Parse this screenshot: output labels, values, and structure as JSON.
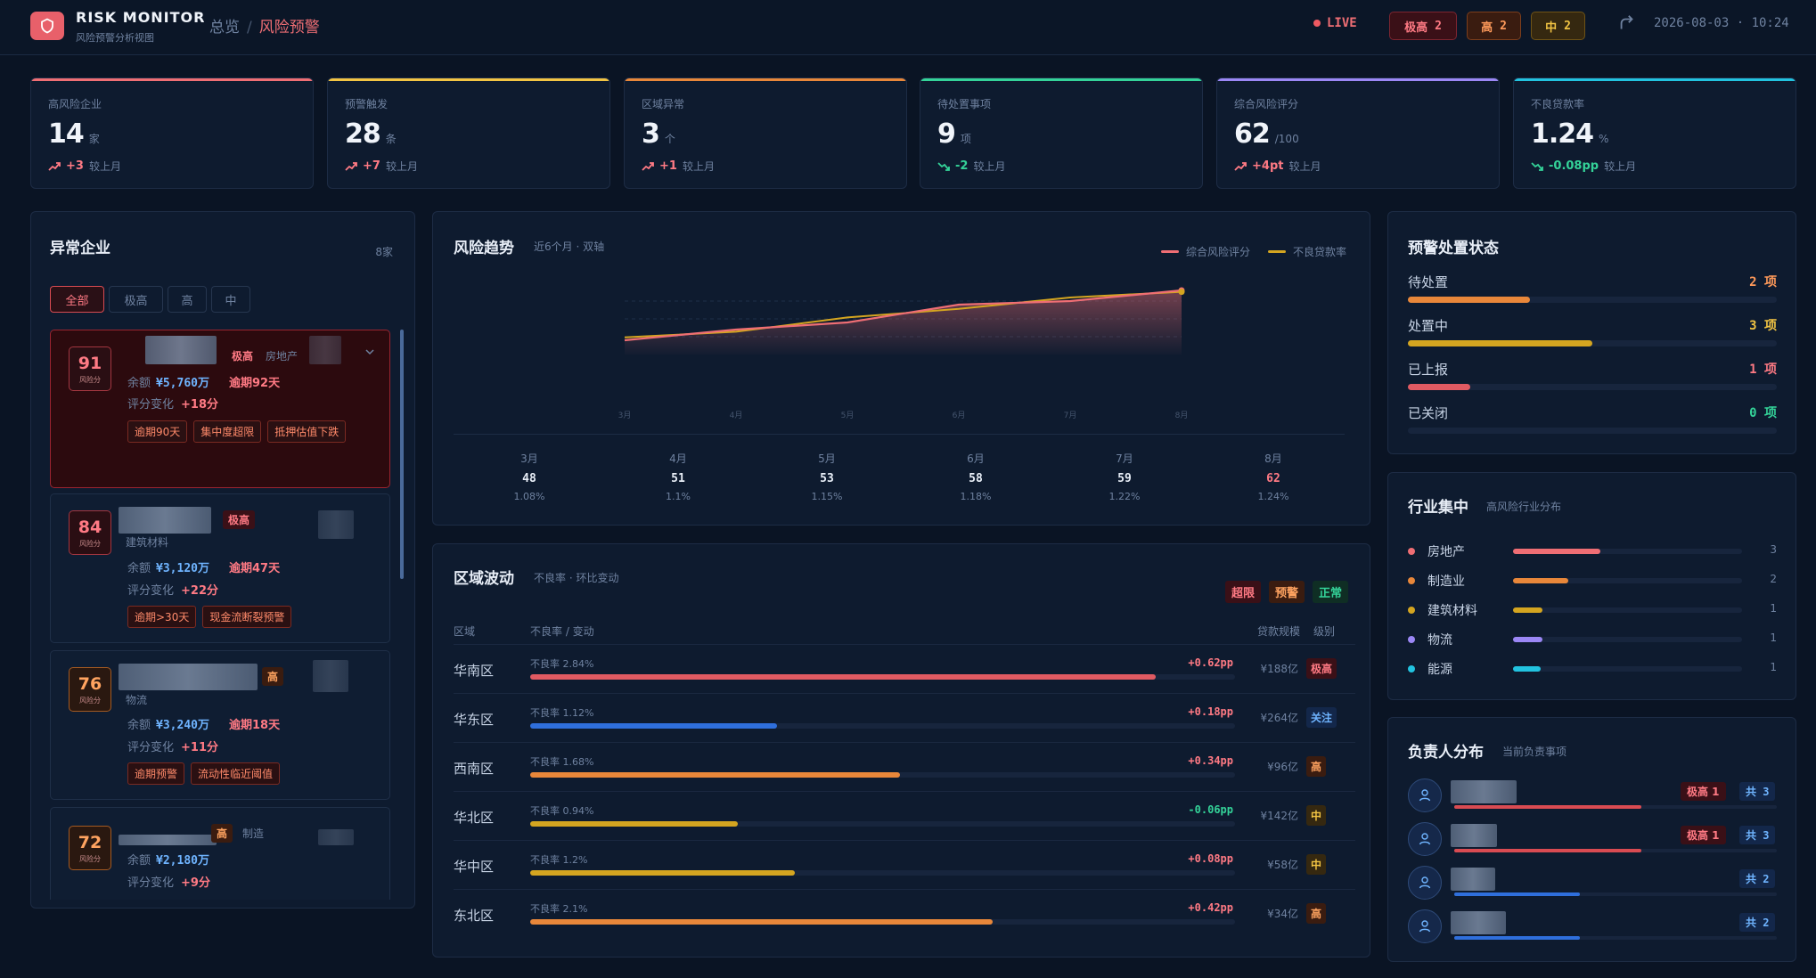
{
  "header": {
    "brand": "RISK MONITOR",
    "brand_sub": "风险预警分析视图",
    "crumb_home": "总览",
    "crumb_sep": "/",
    "crumb_current": "风险预警",
    "live": "LIVE",
    "badge_extreme": {
      "label": "极高",
      "count": "2"
    },
    "badge_high": {
      "label": "高",
      "count": "2"
    },
    "badge_mid": {
      "label": "中",
      "count": "2"
    },
    "datetime": "2026-08-03 · 10:24"
  },
  "colors": {
    "red": "#ef6e74",
    "amber": "#f2c443",
    "orange": "#e8873a",
    "green": "#34d399",
    "purple": "#9b87f5",
    "cyan": "#22c3e0",
    "blue": "#2f6fdc"
  },
  "kpis": [
    {
      "label": "高风险企业",
      "value": "14",
      "unit": "家",
      "change": "+3",
      "cmp": "较上月",
      "dir": "up",
      "color": "#ef6e74"
    },
    {
      "label": "预警触发",
      "value": "28",
      "unit": "条",
      "change": "+7",
      "cmp": "较上月",
      "dir": "up",
      "color": "#f2c443"
    },
    {
      "label": "区域异常",
      "value": "3",
      "unit": "个",
      "change": "+1",
      "cmp": "较上月",
      "dir": "up",
      "color": "#e8873a"
    },
    {
      "label": "待处置事项",
      "value": "9",
      "unit": "项",
      "change": "-2",
      "cmp": "较上月",
      "dir": "down",
      "color": "#34d399"
    },
    {
      "label": "综合风险评分",
      "value": "62",
      "unit": "/100",
      "change": "+4pt",
      "cmp": "较上月",
      "dir": "up",
      "color": "#9b87f5"
    },
    {
      "label": "不良贷款率",
      "value": "1.24",
      "unit": "%",
      "change": "-0.08pp",
      "cmp": "较上月",
      "dir": "down",
      "color": "#22c3e0"
    }
  ],
  "abnormal": {
    "title": "异常企业",
    "count": "8家",
    "filters": [
      "全部",
      "极高",
      "高",
      "中"
    ],
    "items": [
      {
        "score": "91",
        "score_label": "风险分",
        "level": "极高",
        "industry": "房地产",
        "balance_label": "余额",
        "balance": "¥5,760万",
        "overdue": "逾期92天",
        "change_label": "评分变化",
        "change": "+18分",
        "tags": [
          "逾期90天",
          "集中度超限",
          "抵押估值下跌"
        ]
      },
      {
        "score": "84",
        "score_label": "风险分",
        "level": "极高",
        "industry": "建筑材料",
        "balance_label": "余额",
        "balance": "¥3,120万",
        "overdue": "逾期47天",
        "change_label": "评分变化",
        "change": "+22分",
        "tags": [
          "逾期>30天",
          "现金流断裂预警"
        ]
      },
      {
        "score": "76",
        "score_label": "风险分",
        "level": "高",
        "industry": "物流",
        "balance_label": "余额",
        "balance": "¥3,240万",
        "overdue": "逾期18天",
        "change_label": "评分变化",
        "change": "+11分",
        "tags": [
          "逾期预警",
          "流动性临近阈值"
        ]
      },
      {
        "score": "72",
        "score_label": "风险分",
        "level": "高",
        "industry": "制造",
        "balance_label": "余额",
        "balance": "¥2,180万",
        "overdue": "",
        "change_label": "评分变化",
        "change": "+9分",
        "tags": []
      }
    ]
  },
  "trend": {
    "title": "风险趋势",
    "subtitle": "近6个月 · 双轴",
    "legend": [
      "综合风险评分",
      "不良贷款率"
    ]
  },
  "chart_data": {
    "type": "line",
    "x": [
      "3月",
      "4月",
      "5月",
      "6月",
      "7月",
      "8月"
    ],
    "series": [
      {
        "name": "综合风险评分",
        "values": [
          48,
          51,
          53,
          58,
          59,
          62
        ],
        "color": "#ef6e74"
      },
      {
        "name": "不良贷款率",
        "values": [
          1.08,
          1.1,
          1.15,
          1.18,
          1.22,
          1.24
        ],
        "color": "#d4a520"
      }
    ],
    "value_labels": [
      "1.08%",
      "1.1%",
      "1.15%",
      "1.18%",
      "1.22%",
      "1.24%"
    ],
    "axis_ticks": [
      "3月",
      "4月",
      "5月",
      "6月",
      "7月",
      "8月"
    ],
    "ylim_score": [
      44,
      64
    ],
    "ylim_rate": [
      1.02,
      1.27
    ],
    "grid": true,
    "legend_position": "top-right"
  },
  "regional": {
    "title": "区域波动",
    "subtitle": "不良率 · 环比变动",
    "badges": [
      "超限",
      "预警",
      "正常"
    ],
    "headers": {
      "region": "区域",
      "rate": "不良率 / 变动",
      "scale": "贷款规模",
      "level": "级别"
    },
    "rows": [
      {
        "name": "华南区",
        "rate_label": "不良率 2.84%",
        "rate": 2.84,
        "delta": "+0.62pp",
        "scale": "¥188亿",
        "level": "极高",
        "kind": "red"
      },
      {
        "name": "华东区",
        "rate_label": "不良率 1.12%",
        "rate": 1.12,
        "delta": "+0.18pp",
        "scale": "¥264亿",
        "level": "关注",
        "kind": "blue"
      },
      {
        "name": "西南区",
        "rate_label": "不良率 1.68%",
        "rate": 1.68,
        "delta": "+0.34pp",
        "scale": "¥96亿",
        "level": "高",
        "kind": "orange"
      },
      {
        "name": "华北区",
        "rate_label": "不良率 0.94%",
        "rate": 0.94,
        "delta": "-0.06pp",
        "scale": "¥142亿",
        "level": "中",
        "kind": "amber"
      },
      {
        "name": "华中区",
        "rate_label": "不良率 1.2%",
        "rate": 1.2,
        "delta": "+0.08pp",
        "scale": "¥58亿",
        "level": "中",
        "kind": "amber"
      },
      {
        "name": "东北区",
        "rate_label": "不良率 2.1%",
        "rate": 2.1,
        "delta": "+0.42pp",
        "scale": "¥34亿",
        "level": "高",
        "kind": "orange"
      }
    ]
  },
  "status": {
    "title": "预警处置状态",
    "rows": [
      {
        "label": "待处置",
        "value": "2 项",
        "fraction": 0.33,
        "color": "#e8873a",
        "vcolor": "#ff9a5a"
      },
      {
        "label": "处置中",
        "value": "3 项",
        "fraction": 0.5,
        "color": "#d4a520",
        "vcolor": "#f2c443"
      },
      {
        "label": "已上报",
        "value": "1 项",
        "fraction": 0.17,
        "color": "#e05a62",
        "vcolor": "#ff7a84"
      },
      {
        "label": "已关闭",
        "value": "0 项",
        "fraction": 0,
        "color": "#34d399",
        "vcolor": "#34d399"
      }
    ]
  },
  "industry": {
    "title": "行业集中",
    "subtitle": "高风险行业分布",
    "rows": [
      {
        "name": "房地产",
        "count": "3",
        "fraction": 0.38,
        "color": "#ef6e74"
      },
      {
        "name": "制造业",
        "count": "2",
        "fraction": 0.24,
        "color": "#e8873a"
      },
      {
        "name": "建筑材料",
        "count": "1",
        "fraction": 0.13,
        "color": "#d4a520"
      },
      {
        "name": "物流",
        "count": "1",
        "fraction": 0.13,
        "color": "#9b87f5"
      },
      {
        "name": "能源",
        "count": "1",
        "fraction": 0.12,
        "color": "#22c3e0"
      }
    ]
  },
  "owners": {
    "title": "负责人分布",
    "subtitle": "当前负责事项",
    "rows": [
      {
        "ext": "极高 1",
        "total": "共 3",
        "fraction": 0.58,
        "color": "#d94b52"
      },
      {
        "ext": "极高 1",
        "total": "共 3",
        "fraction": 0.58,
        "color": "#d94b52"
      },
      {
        "ext": "",
        "total": "共 2",
        "fraction": 0.39,
        "color": "#2f6fdc"
      },
      {
        "ext": "",
        "total": "共 2",
        "fraction": 0.39,
        "color": "#2f6fdc"
      }
    ]
  }
}
